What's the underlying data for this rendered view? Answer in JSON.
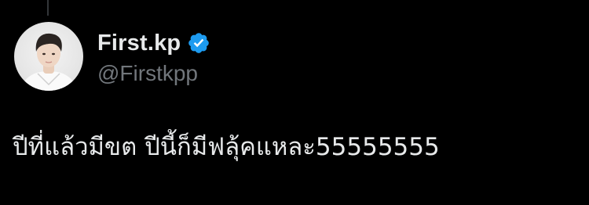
{
  "author": {
    "display_name": "First.kp",
    "handle": "@Firstkpp",
    "verified": true,
    "avatar_icon": "profile-photo"
  },
  "tweet": {
    "text": "ปีที่แล้วมีขต ปีนี้ก็มีฟลุ้คแหละ55555555"
  },
  "colors": {
    "background": "#000000",
    "text_primary": "#e7e9ea",
    "text_secondary": "#71767b",
    "verified_badge": "#1d9bf0",
    "thread_line": "#333639"
  }
}
